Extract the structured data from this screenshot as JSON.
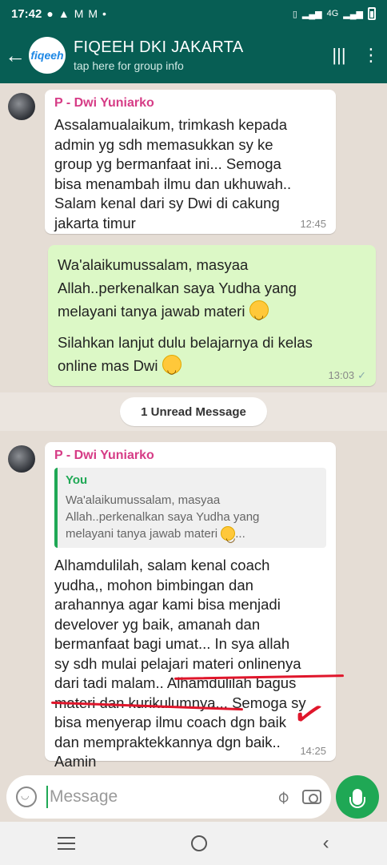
{
  "status": {
    "time": "17:42",
    "network": "4G"
  },
  "header": {
    "avatar_text": "fiqeeh",
    "title": "FIQEEH DKI JAKARTA",
    "subtitle": "tap here for group info"
  },
  "messages": [
    {
      "sender": "P - Dwi Yuniarko",
      "text": "Assalamualaikum,  trimkash kepada\nadmin yg sdh memasukkan sy ke\ngroup yg bermanfaat ini... Semoga\nbisa menambah ilmu dan ukhuwah..\nSalam kenal dari sy Dwi di cakung\njakarta timur",
      "time": "12:45"
    },
    {
      "text_part1": "Wa'alaikumussalam, masyaa\nAllah..perkenalkan saya Yudha yang\nmelayani tanya jawab materi",
      "text_part2": "Silahkan lanjut dulu belajarnya di kelas\nonline mas Dwi",
      "time": "13:03",
      "tick": "✓"
    },
    {
      "sender": "P - Dwi Yuniarko",
      "quote_sender": "You",
      "quote_text": "Wa'alaikumussalam, masyaa\nAllah..perkenalkan saya Yudha yang\nmelayani tanya jawab materi",
      "quote_suffix": "...",
      "text": "Alhamdulilah,  salam kenal coach\nyudha,, mohon bimbingan dan\narahannya agar kami bisa menjadi\ndevelover yg baik,  amanah dan\nbermanfaat bagi umat... In sya allah\nsy sdh mulai pelajari materi onlinenya\ndari tadi malam.. Alhamdulilah bagus\nmateri dan kurikulumnya... Semoga sy\nbisa menyerap ilmu coach dgn baik\ndan mempraktekkannya dgn baik..\nAamin",
      "time": "14:25"
    }
  ],
  "unread_label": "1 Unread Message",
  "input": {
    "placeholder": "Message"
  },
  "colors": {
    "header": "#075e54",
    "accent": "#1fa855",
    "sender": "#d63c86",
    "annotation": "#e0162b"
  }
}
